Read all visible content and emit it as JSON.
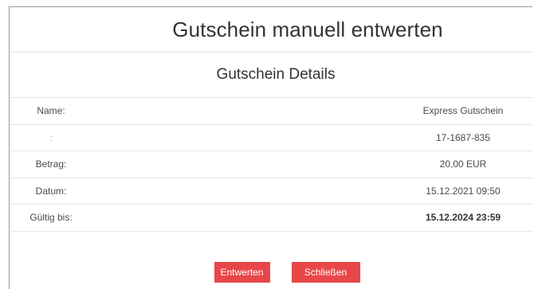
{
  "dialog": {
    "title": "Gutschein manuell entwerten",
    "details_title": "Gutschein Details",
    "rows": [
      {
        "label": "Name:",
        "value": "Express Gutschein"
      },
      {
        "label": ":",
        "value": "17-1687-835"
      },
      {
        "label": "Betrag:",
        "value": "20,00 EUR"
      },
      {
        "label": "Datum:",
        "value": "15.12.2021 09:50"
      },
      {
        "label": "Gültig bis:",
        "value": "15.12.2024 23:59"
      }
    ],
    "buttons": {
      "redeem_label": "Entwerten",
      "close_label": "Schließen"
    }
  },
  "colors": {
    "button_bg": "#e8474a",
    "button_text": "#ffffff",
    "divider": "#e3e3e3",
    "text": "#333333"
  }
}
